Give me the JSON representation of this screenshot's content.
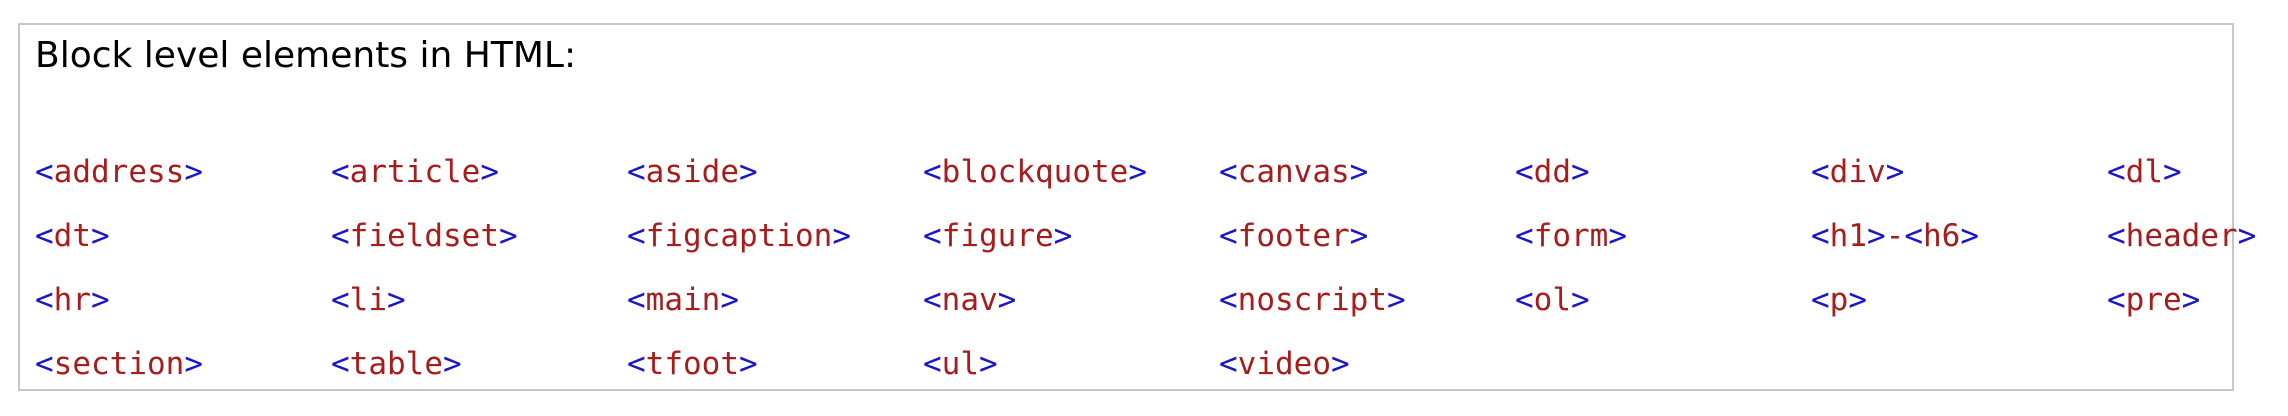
{
  "heading": "Block level elements in HTML:",
  "colors": {
    "bracket": "#1a17c6",
    "name": "#a61d1d",
    "border": "#c7c7c7"
  },
  "elements": [
    {
      "segments": [
        {
          "t": "<",
          "k": "br"
        },
        {
          "t": "address",
          "k": "nm"
        },
        {
          "t": ">",
          "k": "br"
        }
      ]
    },
    {
      "segments": [
        {
          "t": "<",
          "k": "br"
        },
        {
          "t": "article",
          "k": "nm"
        },
        {
          "t": ">",
          "k": "br"
        }
      ]
    },
    {
      "segments": [
        {
          "t": "<",
          "k": "br"
        },
        {
          "t": "aside",
          "k": "nm"
        },
        {
          "t": ">",
          "k": "br"
        }
      ]
    },
    {
      "segments": [
        {
          "t": "<",
          "k": "br"
        },
        {
          "t": "blockquote",
          "k": "nm"
        },
        {
          "t": ">",
          "k": "br"
        }
      ]
    },
    {
      "segments": [
        {
          "t": "<",
          "k": "br"
        },
        {
          "t": "canvas",
          "k": "nm"
        },
        {
          "t": ">",
          "k": "br"
        }
      ]
    },
    {
      "segments": [
        {
          "t": "<",
          "k": "br"
        },
        {
          "t": "dd",
          "k": "nm"
        },
        {
          "t": ">",
          "k": "br"
        }
      ]
    },
    {
      "segments": [
        {
          "t": "<",
          "k": "br"
        },
        {
          "t": "div",
          "k": "nm"
        },
        {
          "t": ">",
          "k": "br"
        }
      ]
    },
    {
      "segments": [
        {
          "t": "<",
          "k": "br"
        },
        {
          "t": "dl",
          "k": "nm"
        },
        {
          "t": ">",
          "k": "br"
        }
      ]
    },
    {
      "segments": [
        {
          "t": "<",
          "k": "br"
        },
        {
          "t": "dt",
          "k": "nm"
        },
        {
          "t": ">",
          "k": "br"
        }
      ]
    },
    {
      "segments": [
        {
          "t": "<",
          "k": "br"
        },
        {
          "t": "fieldset",
          "k": "nm"
        },
        {
          "t": ">",
          "k": "br"
        }
      ]
    },
    {
      "segments": [
        {
          "t": "<",
          "k": "br"
        },
        {
          "t": "figcaption",
          "k": "nm"
        },
        {
          "t": ">",
          "k": "br"
        }
      ]
    },
    {
      "segments": [
        {
          "t": "<",
          "k": "br"
        },
        {
          "t": "figure",
          "k": "nm"
        },
        {
          "t": ">",
          "k": "br"
        }
      ]
    },
    {
      "segments": [
        {
          "t": "<",
          "k": "br"
        },
        {
          "t": "footer",
          "k": "nm"
        },
        {
          "t": ">",
          "k": "br"
        }
      ]
    },
    {
      "segments": [
        {
          "t": "<",
          "k": "br"
        },
        {
          "t": "form",
          "k": "nm"
        },
        {
          "t": ">",
          "k": "br"
        }
      ]
    },
    {
      "segments": [
        {
          "t": "<",
          "k": "br"
        },
        {
          "t": "h1",
          "k": "nm"
        },
        {
          "t": ">",
          "k": "br"
        },
        {
          "t": "-",
          "k": "nm"
        },
        {
          "t": "<",
          "k": "br"
        },
        {
          "t": "h6",
          "k": "nm"
        },
        {
          "t": ">",
          "k": "br"
        }
      ]
    },
    {
      "segments": [
        {
          "t": "<",
          "k": "br"
        },
        {
          "t": "header",
          "k": "nm"
        },
        {
          "t": ">",
          "k": "br"
        }
      ]
    },
    {
      "segments": [
        {
          "t": "<",
          "k": "br"
        },
        {
          "t": "hr",
          "k": "nm"
        },
        {
          "t": ">",
          "k": "br"
        }
      ]
    },
    {
      "segments": [
        {
          "t": "<",
          "k": "br"
        },
        {
          "t": "li",
          "k": "nm"
        },
        {
          "t": ">",
          "k": "br"
        }
      ]
    },
    {
      "segments": [
        {
          "t": "<",
          "k": "br"
        },
        {
          "t": "main",
          "k": "nm"
        },
        {
          "t": ">",
          "k": "br"
        }
      ]
    },
    {
      "segments": [
        {
          "t": "<",
          "k": "br"
        },
        {
          "t": "nav",
          "k": "nm"
        },
        {
          "t": ">",
          "k": "br"
        }
      ]
    },
    {
      "segments": [
        {
          "t": "<",
          "k": "br"
        },
        {
          "t": "noscript",
          "k": "nm"
        },
        {
          "t": ">",
          "k": "br"
        }
      ]
    },
    {
      "segments": [
        {
          "t": "<",
          "k": "br"
        },
        {
          "t": "ol",
          "k": "nm"
        },
        {
          "t": ">",
          "k": "br"
        }
      ]
    },
    {
      "segments": [
        {
          "t": "<",
          "k": "br"
        },
        {
          "t": "p",
          "k": "nm"
        },
        {
          "t": ">",
          "k": "br"
        }
      ]
    },
    {
      "segments": [
        {
          "t": "<",
          "k": "br"
        },
        {
          "t": "pre",
          "k": "nm"
        },
        {
          "t": ">",
          "k": "br"
        }
      ]
    },
    {
      "segments": [
        {
          "t": "<",
          "k": "br"
        },
        {
          "t": "section",
          "k": "nm"
        },
        {
          "t": ">",
          "k": "br"
        }
      ]
    },
    {
      "segments": [
        {
          "t": "<",
          "k": "br"
        },
        {
          "t": "table",
          "k": "nm"
        },
        {
          "t": ">",
          "k": "br"
        }
      ]
    },
    {
      "segments": [
        {
          "t": "<",
          "k": "br"
        },
        {
          "t": "tfoot",
          "k": "nm"
        },
        {
          "t": ">",
          "k": "br"
        }
      ]
    },
    {
      "segments": [
        {
          "t": "<",
          "k": "br"
        },
        {
          "t": "ul",
          "k": "nm"
        },
        {
          "t": ">",
          "k": "br"
        }
      ]
    },
    {
      "segments": [
        {
          "t": "<",
          "k": "br"
        },
        {
          "t": "video",
          "k": "nm"
        },
        {
          "t": ">",
          "k": "br"
        }
      ]
    }
  ]
}
